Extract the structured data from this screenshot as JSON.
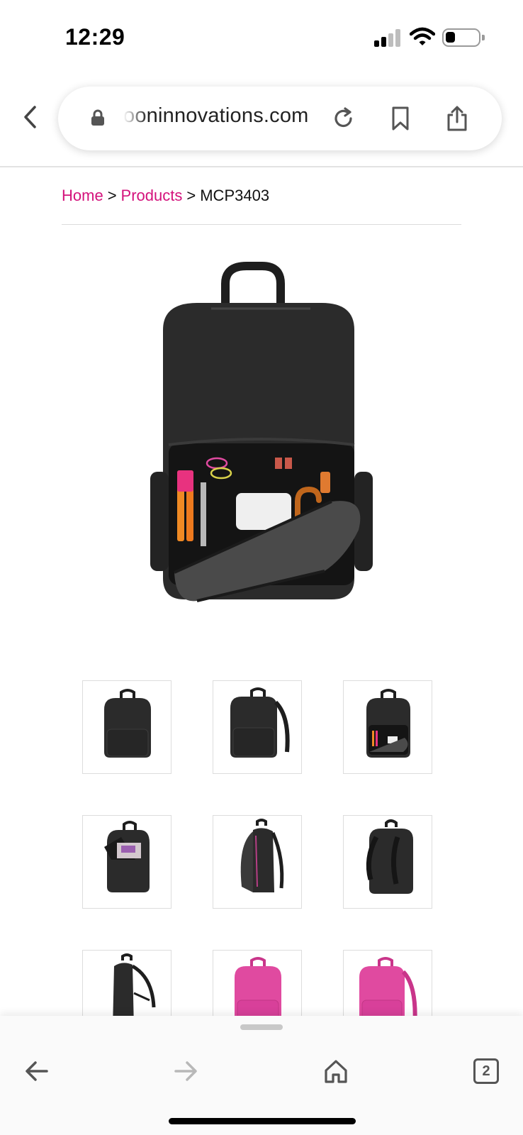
{
  "status_bar": {
    "time": "12:29",
    "signal_icon": "cellular-signal-icon",
    "wifi_icon": "wifi-icon",
    "battery_icon": "battery-low-icon",
    "battery_level": 0.3
  },
  "browser": {
    "url": "ooninnovations.com",
    "icons": [
      "back-chevron-icon",
      "lock-icon",
      "reload-icon",
      "bookmark-icon",
      "share-icon"
    ]
  },
  "breadcrumb": {
    "home": "Home",
    "products": "Products",
    "current": "MCP3403",
    "separator": ">"
  },
  "colors": {
    "link": "#d4137c",
    "backpack_black": "#2b2b2b",
    "backpack_pink": "#e04aa0",
    "thumb_border": "#dddddd"
  },
  "thumbnails": [
    {
      "view": "front",
      "color": "black"
    },
    {
      "view": "three-quarter",
      "color": "black"
    },
    {
      "view": "open-organizer",
      "color": "black"
    },
    {
      "view": "open-laptop",
      "color": "black"
    },
    {
      "view": "side-open",
      "color": "black"
    },
    {
      "view": "back",
      "color": "black"
    },
    {
      "view": "side",
      "color": "black"
    },
    {
      "view": "front",
      "color": "pink"
    },
    {
      "view": "three-quarter",
      "color": "pink"
    }
  ],
  "toolbar": {
    "icons": [
      "back-arrow-icon",
      "forward-arrow-icon",
      "home-icon",
      "tabs-icon"
    ],
    "tab_count": "2"
  }
}
